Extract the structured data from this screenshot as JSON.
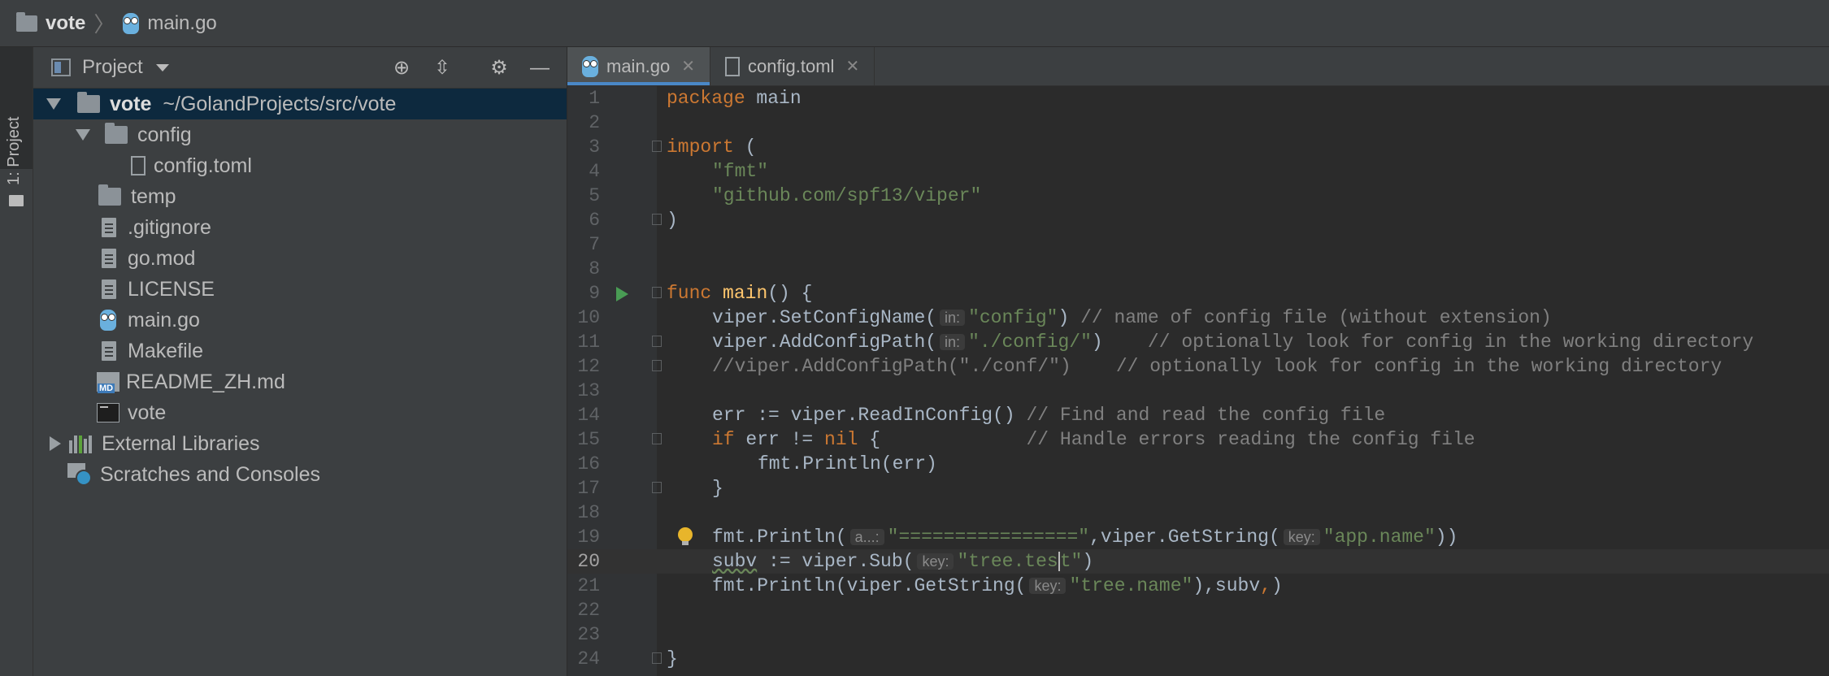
{
  "breadcrumb": {
    "project": "vote",
    "file": "main.go"
  },
  "stripe": {
    "label": "1: Project"
  },
  "panel": {
    "title": "Project"
  },
  "tree": [
    {
      "label": "vote",
      "path": "~/GolandProjects/src/vote"
    },
    {
      "label": "config"
    },
    {
      "label": "config.toml"
    },
    {
      "label": "temp"
    },
    {
      "label": ".gitignore"
    },
    {
      "label": "go.mod"
    },
    {
      "label": "LICENSE"
    },
    {
      "label": "main.go"
    },
    {
      "label": "Makefile"
    },
    {
      "label": "README_ZH.md"
    },
    {
      "label": "vote"
    },
    {
      "label": "External Libraries"
    },
    {
      "label": "Scratches and Consoles"
    }
  ],
  "tabs": [
    {
      "label": "main.go",
      "active": true
    },
    {
      "label": "config.toml",
      "active": false
    }
  ],
  "editor": {
    "current_line": 20,
    "lines": [
      {
        "n": "1",
        "t": "package main"
      },
      {
        "n": "2",
        "t": ""
      },
      {
        "n": "3",
        "t": "import ("
      },
      {
        "n": "4",
        "t": "\"fmt\""
      },
      {
        "n": "5",
        "t": "\"github.com/spf13/viper\""
      },
      {
        "n": "6",
        "t": ")"
      },
      {
        "n": "7",
        "t": ""
      },
      {
        "n": "8",
        "t": ""
      },
      {
        "n": "9",
        "t": "func main() {"
      },
      {
        "n": "10",
        "t": "viper.SetConfigName(",
        "hint": "in:",
        "s": "\"config\"",
        "after": ") // name of config file (without extension)"
      },
      {
        "n": "11",
        "t": "viper.AddConfigPath(",
        "hint": "in:",
        "s": "\"./config/\"",
        "after": ")    // optionally look for config in the working directory"
      },
      {
        "n": "12",
        "t": "//viper.AddConfigPath(\"./conf/\")    // optionally look for config in the working directory"
      },
      {
        "n": "13",
        "t": ""
      },
      {
        "n": "14",
        "t": "err := viper.ReadInConfig() // Find and read the config file"
      },
      {
        "n": "15",
        "t": "if err != nil {             // Handle errors reading the config file"
      },
      {
        "n": "16",
        "t": "fmt.Println(err)"
      },
      {
        "n": "17",
        "t": "}"
      },
      {
        "n": "18",
        "t": ""
      },
      {
        "n": "19",
        "t": "fmt.Println(",
        "hint": "a...:",
        "s": "\"================\"",
        "mid": ",viper.GetString(",
        "hint2": "key:",
        "s2": "\"app.name\"",
        "after": "))"
      },
      {
        "n": "20",
        "t": "subv := viper.Sub(",
        "hint": "key:",
        "s": "\"tree.test\"",
        "after": ")"
      },
      {
        "n": "21",
        "t": "fmt.Println(viper.GetString(",
        "hint": "key:",
        "s": "\"tree.name\"",
        "after": "),subv,)"
      },
      {
        "n": "22",
        "t": ""
      },
      {
        "n": "23",
        "t": ""
      },
      {
        "n": "24",
        "t": "}"
      }
    ]
  }
}
